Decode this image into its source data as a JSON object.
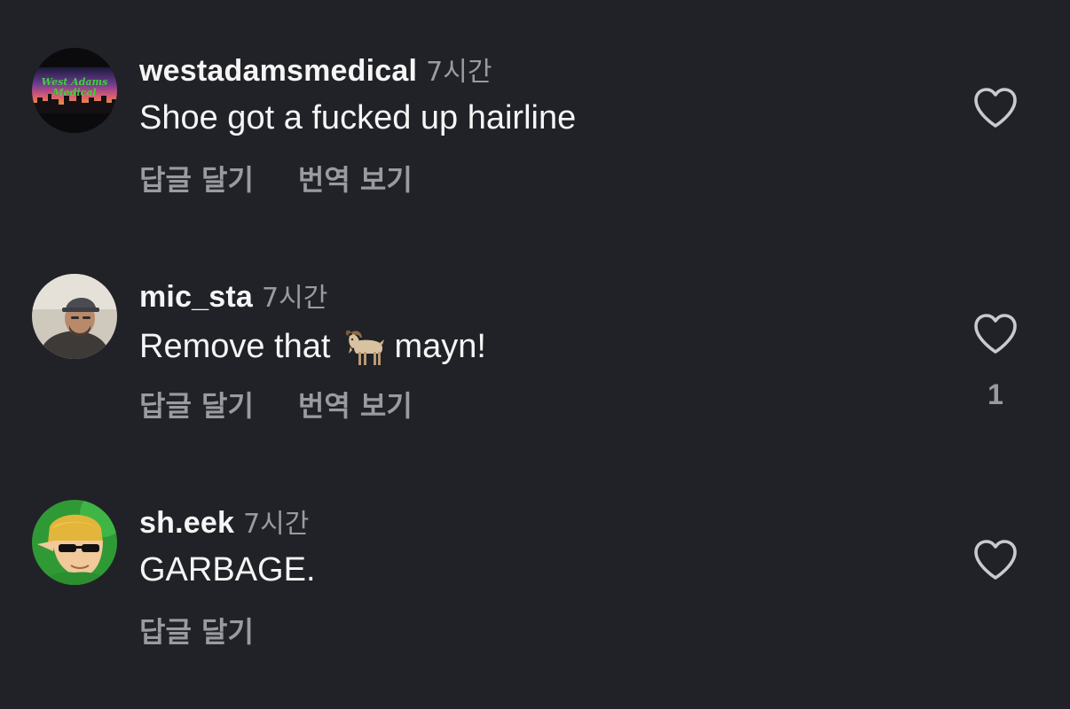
{
  "comments": [
    {
      "username": "westadamsmedical",
      "time": "7시간",
      "text": "Shoe got a fucked up hairline",
      "avatar_icon": "west-adams-medical-logo",
      "reply_label": "답글 달기",
      "translate_label": "번역 보기",
      "likes": ""
    },
    {
      "username": "mic_sta",
      "time": "7시간",
      "text_before": "Remove that",
      "emoji_icon": "goat-emoji",
      "text_after": "mayn!",
      "avatar_icon": "user-photo",
      "reply_label": "답글 달기",
      "translate_label": "번역 보기",
      "likes": "1"
    },
    {
      "username": "sh.eek",
      "time": "7시간",
      "text": "GARBAGE.",
      "avatar_icon": "cartoon-character-avatar",
      "reply_label": "답글 달기",
      "likes": ""
    }
  ],
  "avatar_logo_text": [
    "West Adams",
    "Medical"
  ],
  "colors": {
    "background": "#212227",
    "primary_text": "#f5f5f5",
    "secondary_text": "#9a9ba1",
    "heart_outline": "#c9cacd"
  }
}
